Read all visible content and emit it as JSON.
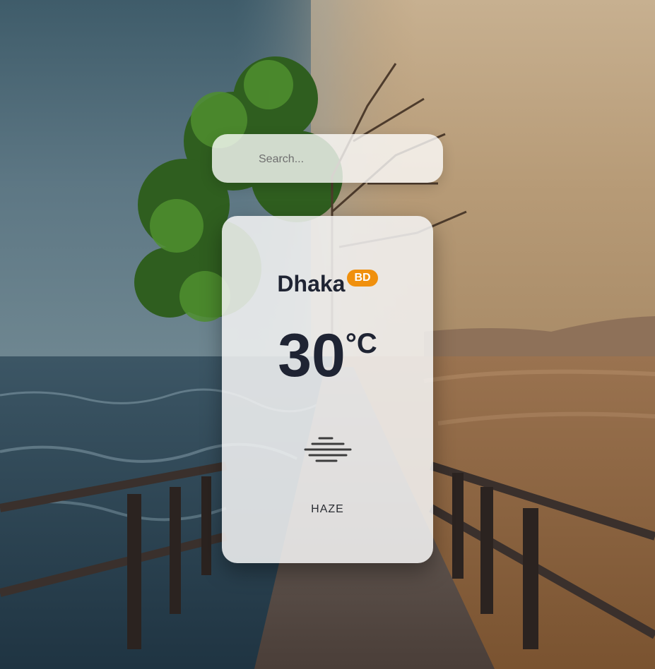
{
  "search": {
    "placeholder": "Search..."
  },
  "weather": {
    "city": "Dhaka",
    "country": "BD",
    "temperature": "30",
    "unit": "°C",
    "condition": "HAZE",
    "icon": "haze-icon"
  },
  "colors": {
    "badge": "#f0900d",
    "text_dark": "#1f2433",
    "card_bg": "#f4f4f4"
  }
}
